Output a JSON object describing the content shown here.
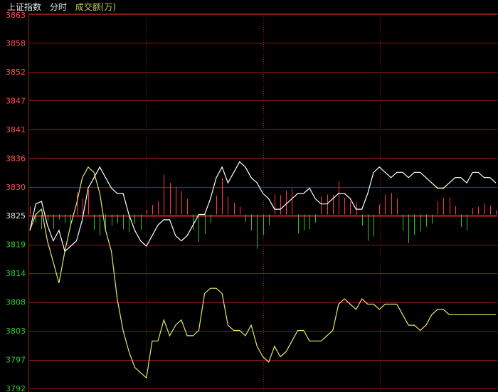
{
  "header": {
    "index_name": "上证指数",
    "mode": "分时",
    "volume_label": "成交额(万)"
  },
  "colors": {
    "background": "#000000",
    "grid": "#8a1a1a",
    "grid_mid": "#cc2222",
    "axis_text_up": "#ff5050",
    "axis_text_mid": "#e6e6e6",
    "axis_text_down": "#33cc33",
    "price_line": "#ffffff",
    "avg_line": "#e6e66e",
    "vol_up": "#ff3b3b",
    "vol_down": "#30c030"
  },
  "chart_data": {
    "type": "line",
    "prev_close": 3825,
    "ylim": [
      3792,
      3863
    ],
    "y_ticks": [
      "3863",
      "3858",
      "3852",
      "3847",
      "3841",
      "3836",
      "3830",
      "3825",
      "3819",
      "3814",
      "3808",
      "3803",
      "3797",
      "3792"
    ],
    "x_sessions": 4,
    "series": [
      {
        "key": "price",
        "values": [
          3822,
          3827,
          3827.5,
          3823,
          3820,
          3822,
          3818,
          3819,
          3820,
          3824,
          3830,
          3832,
          3834,
          3832,
          3830,
          3829,
          3829,
          3825,
          3822,
          3820,
          3819,
          3821,
          3823,
          3824,
          3824,
          3821,
          3820,
          3821,
          3823,
          3825,
          3825,
          3828,
          3832,
          3834,
          3831,
          3833,
          3835,
          3834,
          3832,
          3831,
          3829,
          3828,
          3826,
          3826,
          3827,
          3828,
          3829,
          3829,
          3830,
          3828,
          3827,
          3827,
          3828,
          3829,
          3829,
          3828,
          3826,
          3826,
          3829,
          3833,
          3834,
          3833,
          3832,
          3833,
          3833,
          3832,
          3833,
          3833,
          3832,
          3831,
          3830,
          3830,
          3831,
          3832,
          3832,
          3831,
          3833,
          3833,
          3832,
          3832,
          3831
        ],
        "color": "white"
      },
      {
        "key": "avg",
        "values": [
          3822,
          3825,
          3826,
          3820,
          3816,
          3812,
          3818,
          3823,
          3827,
          3832,
          3834,
          3833,
          3829,
          3822,
          3818,
          3809,
          3803,
          3799,
          3796,
          3795,
          3794,
          3801,
          3801,
          3805,
          3802,
          3804,
          3805,
          3802,
          3802,
          3803,
          3810,
          3811,
          3811,
          3810,
          3804,
          3803,
          3803,
          3802,
          3804,
          3800,
          3798,
          3797,
          3800,
          3798,
          3799,
          3801,
          3803,
          3803,
          3801,
          3801,
          3801,
          3802,
          3803,
          3808,
          3809,
          3808,
          3807,
          3809,
          3808,
          3808,
          3807,
          3808,
          3808,
          3808,
          3806,
          3804,
          3804,
          3803,
          3804,
          3806,
          3807,
          3807,
          3806,
          3806,
          3806,
          3806,
          3806,
          3806,
          3806,
          3806,
          3806
        ],
        "color": "yellow"
      },
      {
        "key": "volume",
        "values": [
          1.5,
          -1.6,
          -2.8,
          -1.3,
          -2.7,
          -0.9,
          -1.6,
          -1.8,
          4.2,
          3.1,
          4.7,
          -2.9,
          -4.0,
          -3.0,
          -2.1,
          -1.7,
          -2.8,
          -3.3,
          -1.8,
          -2.9,
          0.9,
          1.8,
          2.5,
          7.6,
          6.0,
          5.3,
          4.4,
          2.9,
          -2.9,
          -5.2,
          -3.7,
          -1.6,
          3.6,
          6.9,
          3.4,
          2.2,
          1.5,
          -1.4,
          -3.0,
          -6.5,
          -3.9,
          -2.0,
          3.8,
          3.7,
          4.5,
          4.9,
          -3.6,
          -3.0,
          -2.8,
          -1.5,
          3.5,
          3.8,
          3.7,
          6.4,
          3.2,
          2.4,
          2.3,
          -2.1,
          -5.0,
          -4.2,
          1.9,
          3.8,
          4.1,
          3.0,
          -3.1,
          -5.4,
          -3.9,
          -3.2,
          -2.3,
          -1.7,
          2.5,
          3.2,
          3.3,
          1.6,
          -2.4,
          -3.0,
          1.2,
          1.5,
          2.1,
          1.7,
          0.8
        ],
        "color": "red/green"
      }
    ],
    "grid": true
  }
}
